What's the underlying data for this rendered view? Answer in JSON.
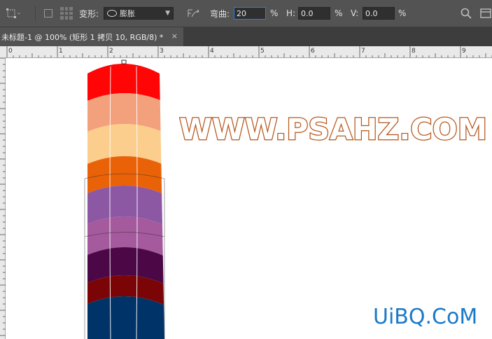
{
  "toolbar": {
    "warp_label": "变形:",
    "warp_style": "膨胀",
    "bend_label": "弯曲:",
    "bend_value": "20",
    "h_label": "H:",
    "h_value": "0.0",
    "v_label": "V:",
    "v_value": "0.0",
    "percent": "%",
    "icons": [
      "transform-icon",
      "grid-toggle-icon",
      "warp-orientation-icon",
      "search-icon",
      "workspace-icon"
    ]
  },
  "document": {
    "tab_title": "未标题-1 @ 100% (矩形 1 拷贝 10, RGB/8) *",
    "close_symbol": "×"
  },
  "ruler": {
    "top_labels": [
      "0",
      "1",
      "2",
      "3",
      "4",
      "5",
      "6",
      "7",
      "8",
      "9"
    ]
  },
  "canvas": {
    "watermark_text": "WWW.PSAHZ.COM",
    "corner_text": "UiBQ.CoM",
    "stripe_colors": [
      "#ff0505",
      "#f3a07c",
      "#fcce8d",
      "#ea6208",
      "#8c57a3",
      "#a45a9d",
      "#4c0846",
      "#7b0506",
      "#003468"
    ]
  },
  "colors": {
    "watermark_fill": "#ffffff",
    "watermark_stroke": "#b7561c",
    "corner_text": "#1a79c9"
  }
}
